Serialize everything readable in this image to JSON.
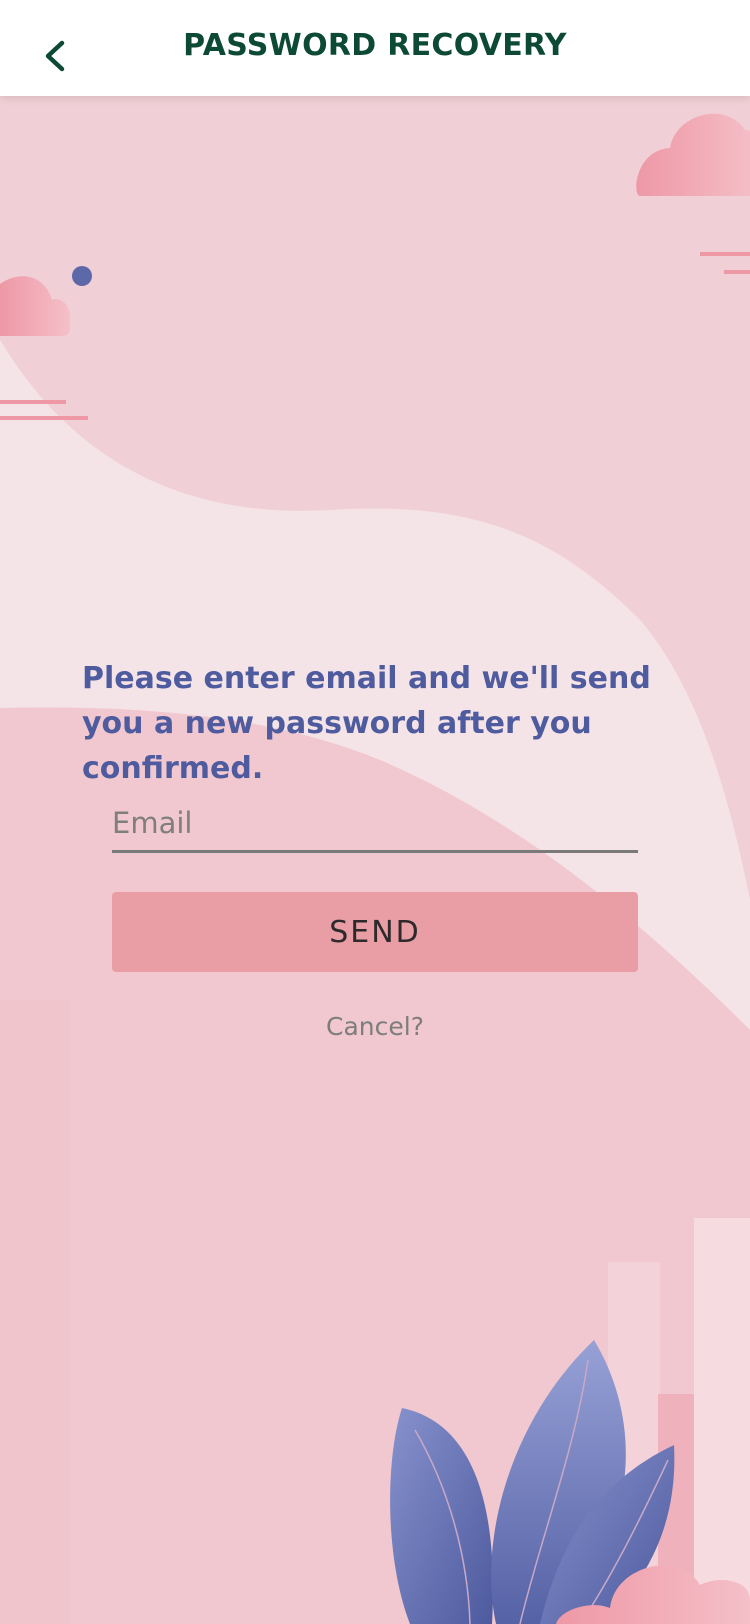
{
  "header": {
    "title": "PASSWORD RECOVERY",
    "back_icon": "chevron-left-icon"
  },
  "form": {
    "instruction": "Please enter email and we'll send you a new password after you confirmed.",
    "email_placeholder": "Email",
    "email_value": "",
    "send_label": "SEND",
    "cancel_label": "Cancel?"
  },
  "colors": {
    "title": "#0c4a36",
    "instruction": "#4e5b9e",
    "button": "#e99ea6",
    "background": "#f0d0d6"
  }
}
